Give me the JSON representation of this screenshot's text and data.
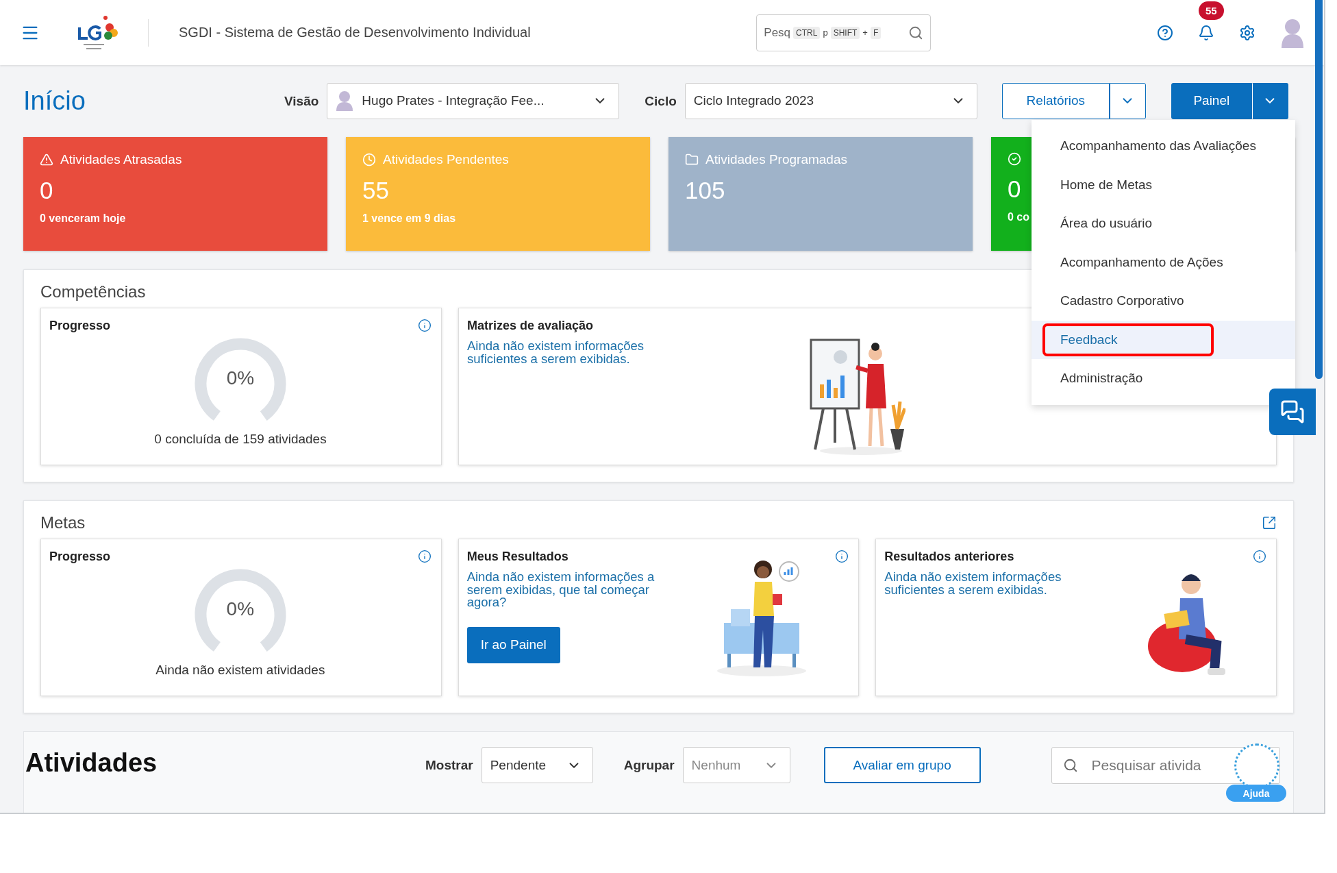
{
  "header": {
    "title": "SGDI - Sistema de Gestão de Desenvolvimento Individual",
    "search": {
      "placeholder": "Pesq",
      "shortcut": [
        {
          "kind": "key",
          "text": "CTRL"
        },
        {
          "kind": "sep",
          "text": "p"
        },
        {
          "kind": "key",
          "text": "SHIFT"
        },
        {
          "kind": "sep",
          "text": "+"
        },
        {
          "kind": "key",
          "text": "F"
        }
      ]
    },
    "notifications": "55"
  },
  "toolbar": {
    "title": "Início",
    "view_label": "Visão",
    "view_value": "Hugo Prates - Integração Fee...",
    "cycle_label": "Ciclo",
    "cycle_value": "Ciclo Integrado 2023",
    "reports_button": "Relatórios",
    "panel_button": "Painel"
  },
  "stats": [
    {
      "kind": "alert",
      "title": "Atividades Atrasadas",
      "value": "0",
      "note": "0 venceram hoje",
      "color": "#e84c3d"
    },
    {
      "kind": "clock",
      "title": "Atividades Pendentes",
      "value": "55",
      "note": "1 vence em 9 dias",
      "color": "#fbbb3b"
    },
    {
      "kind": "folder",
      "title": "Atividades Programadas",
      "value": "105",
      "color": "#9fb3c9"
    },
    {
      "kind": "check",
      "value": "0",
      "note": "0 co",
      "color": "#12b01c"
    }
  ],
  "menu": {
    "items": [
      {
        "label": "Acompanhamento das Avaliações",
        "selected": false
      },
      {
        "label": "Home de Metas",
        "selected": false
      },
      {
        "label": "Área do usuário",
        "selected": false
      },
      {
        "label": "Acompanhamento de Ações",
        "selected": false
      },
      {
        "label": "Cadastro Corporativo",
        "selected": false
      },
      {
        "label": "Feedback",
        "selected": true
      },
      {
        "label": "Administração",
        "selected": false
      }
    ]
  },
  "sections": [
    {
      "title": "Competências",
      "expandable": false,
      "cards": [
        {
          "kind": "progress",
          "title": "Progresso",
          "info": true,
          "value": "0%",
          "level": 0,
          "caption": "0 concluída de 159 atividades"
        },
        {
          "kind": "message",
          "title": "Matrizes de avaliação",
          "info": false,
          "text": "Ainda não existem informações suficientes a serem exibidas."
        }
      ]
    },
    {
      "title": "Metas",
      "expandable": true,
      "cards": [
        {
          "kind": "progress",
          "title": "Progresso",
          "info": true,
          "value": "0%",
          "level": 0,
          "caption": "Ainda não existem atividades"
        },
        {
          "kind": "message",
          "title": "Meus Resultados",
          "info": true,
          "text": "Ainda não existem informações a serem exibidas, que tal começar agora?",
          "button": "Ir ao Painel"
        },
        {
          "kind": "message",
          "title": "Resultados anteriores",
          "info": true,
          "text": "Ainda não existem informações suficientes a serem exibidas."
        }
      ]
    }
  ],
  "activities": {
    "title": "Atividades",
    "show_label": "Mostrar",
    "show_value": "Pendente",
    "group_label": "Agrupar",
    "group_value": "Nenhum",
    "group_button": "Avaliar em grupo",
    "search_placeholder": "Pesquisar ativida"
  },
  "help_badge": "Ajuda"
}
